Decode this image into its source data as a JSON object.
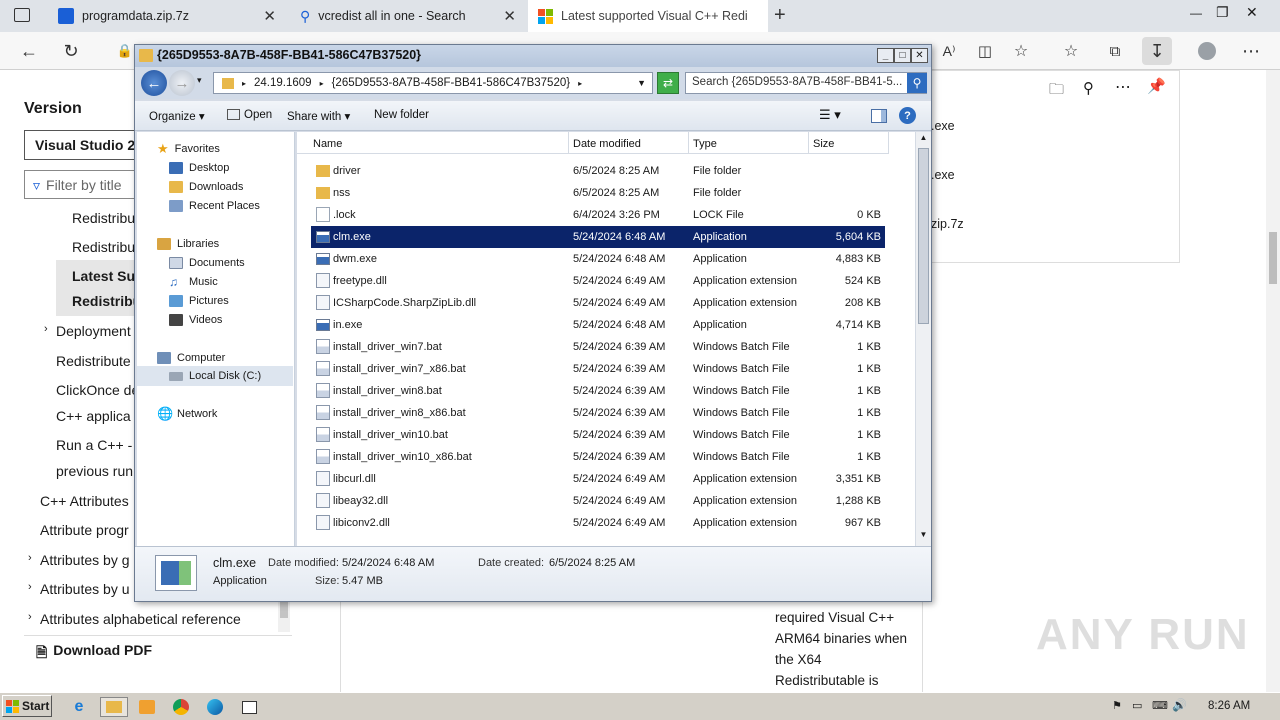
{
  "browser": {
    "tabs": [
      {
        "label": "programdata.zip.7z",
        "active": false
      },
      {
        "label": "vcredist all in one - Search",
        "active": false
      },
      {
        "label": "Latest supported Visual C++ Redi",
        "active": true
      }
    ],
    "new_tab": "+",
    "window_controls": [
      "—",
      "❐",
      "✕"
    ]
  },
  "webpage": {
    "version_label": "Version",
    "version_select": "Visual Studio 20",
    "filter_placeholder": "Filter by title",
    "toc": [
      "Redistribu",
      "Redistribu",
      "Latest Sup",
      "Redistribu",
      "Deployment",
      "Redistribute",
      "ClickOnce de",
      "C++ applica",
      "Run a C++ -",
      "previous run",
      "C++ Attributes",
      "Attribute progr",
      "Attributes by g",
      "Attributes by u",
      "Attributes alphabetical reference"
    ],
    "download_pdf": "Download PDF",
    "downloads_panel": [
      ".exe",
      ".exe",
      "zip.7z"
    ],
    "article_text": [
      "required Visual C++",
      "ARM64 binaries when",
      "the X64",
      "Redistributable is"
    ],
    "watermark": "ANY RUN"
  },
  "explorer": {
    "title": "{265D9553-8A7B-458F-BB41-586C47B37520}",
    "breadcrumb": [
      "24.19.1609",
      "{265D9553-8A7B-458F-BB41-586C47B37520}"
    ],
    "search_placeholder": "Search {265D9553-8A7B-458F-BB41-5...",
    "commands": {
      "organize": "Organize",
      "open": "Open",
      "share_with": "Share with",
      "new_folder": "New folder"
    },
    "nav": {
      "favorites": "Favorites",
      "favorites_items": [
        "Desktop",
        "Downloads",
        "Recent Places"
      ],
      "libraries": "Libraries",
      "libraries_items": [
        "Documents",
        "Music",
        "Pictures",
        "Videos"
      ],
      "computer": "Computer",
      "computer_items": [
        "Local Disk (C:)"
      ],
      "network": "Network"
    },
    "columns": [
      "Name",
      "Date modified",
      "Type",
      "Size"
    ],
    "files": [
      {
        "name": "driver",
        "date": "6/5/2024 8:25 AM",
        "type": "File folder",
        "size": "",
        "icon": "folder"
      },
      {
        "name": "nss",
        "date": "6/5/2024 8:25 AM",
        "type": "File folder",
        "size": "",
        "icon": "folder"
      },
      {
        "name": ".lock",
        "date": "6/4/2024 3:26 PM",
        "type": "LOCK File",
        "size": "0 KB",
        "icon": "file"
      },
      {
        "name": "clm.exe",
        "date": "5/24/2024 6:48 AM",
        "type": "Application",
        "size": "5,604 KB",
        "icon": "exe"
      },
      {
        "name": "dwm.exe",
        "date": "5/24/2024 6:48 AM",
        "type": "Application",
        "size": "4,883 KB",
        "icon": "exe"
      },
      {
        "name": "freetype.dll",
        "date": "5/24/2024 6:49 AM",
        "type": "Application extension",
        "size": "524 KB",
        "icon": "dll"
      },
      {
        "name": "ICSharpCode.SharpZipLib.dll",
        "date": "5/24/2024 6:49 AM",
        "type": "Application extension",
        "size": "208 KB",
        "icon": "dll"
      },
      {
        "name": "in.exe",
        "date": "5/24/2024 6:48 AM",
        "type": "Application",
        "size": "4,714 KB",
        "icon": "exe"
      },
      {
        "name": "install_driver_win7.bat",
        "date": "5/24/2024 6:39 AM",
        "type": "Windows Batch File",
        "size": "1 KB",
        "icon": "bat"
      },
      {
        "name": "install_driver_win7_x86.bat",
        "date": "5/24/2024 6:39 AM",
        "type": "Windows Batch File",
        "size": "1 KB",
        "icon": "bat"
      },
      {
        "name": "install_driver_win8.bat",
        "date": "5/24/2024 6:39 AM",
        "type": "Windows Batch File",
        "size": "1 KB",
        "icon": "bat"
      },
      {
        "name": "install_driver_win8_x86.bat",
        "date": "5/24/2024 6:39 AM",
        "type": "Windows Batch File",
        "size": "1 KB",
        "icon": "bat"
      },
      {
        "name": "install_driver_win10.bat",
        "date": "5/24/2024 6:39 AM",
        "type": "Windows Batch File",
        "size": "1 KB",
        "icon": "bat"
      },
      {
        "name": "install_driver_win10_x86.bat",
        "date": "5/24/2024 6:39 AM",
        "type": "Windows Batch File",
        "size": "1 KB",
        "icon": "bat"
      },
      {
        "name": "libcurl.dll",
        "date": "5/24/2024 6:49 AM",
        "type": "Application extension",
        "size": "3,351 KB",
        "icon": "dll"
      },
      {
        "name": "libeay32.dll",
        "date": "5/24/2024 6:49 AM",
        "type": "Application extension",
        "size": "1,288 KB",
        "icon": "dll"
      },
      {
        "name": "libiconv2.dll",
        "date": "5/24/2024 6:49 AM",
        "type": "Application extension",
        "size": "967 KB",
        "icon": "dll"
      }
    ],
    "selected_index": 3,
    "details": {
      "name": "clm.exe",
      "kind": "Application",
      "date_modified_label": "Date modified:",
      "date_modified": "5/24/2024 6:48 AM",
      "date_created_label": "Date created:",
      "date_created": "6/5/2024 8:25 AM",
      "size_label": "Size:",
      "size": "5.47 MB"
    }
  },
  "taskbar": {
    "start": "Start",
    "clock": "8:26 AM"
  },
  "colors": {
    "selection": "#0b246a",
    "folder": "#e8b84a",
    "tab_strip": "#dfe3e8"
  }
}
